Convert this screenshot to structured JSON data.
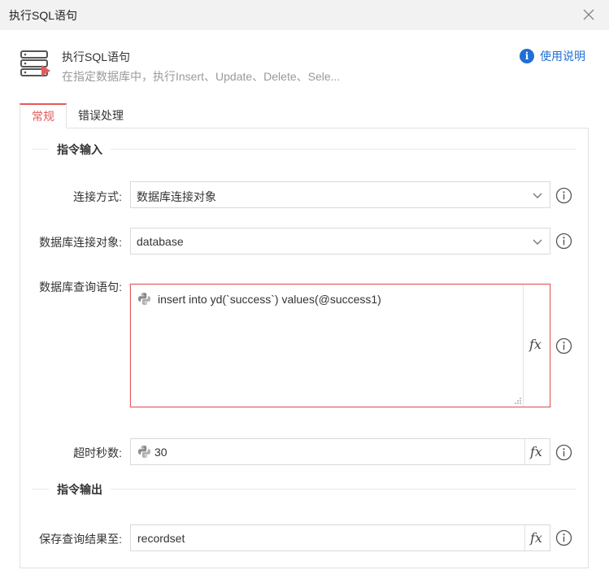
{
  "window": {
    "title": "执行SQL语句",
    "close_icon": "close-icon"
  },
  "header": {
    "icon": "sql-server-run-icon",
    "title": "执行SQL语句",
    "description": "在指定数据库中，执行Insert、Update、Delete、Sele...",
    "help_label": "使用说明",
    "help_icon": "info-circle-icon",
    "help_color": "#1f6fd6"
  },
  "tabs": [
    {
      "label": "常规",
      "active": true
    },
    {
      "label": "错误处理",
      "active": false
    }
  ],
  "sections": {
    "input_title": "指令输入",
    "output_title": "指令输出"
  },
  "fields": {
    "connection_mode": {
      "label": "连接方式:",
      "value": "数据库连接对象"
    },
    "connection_object": {
      "label": "数据库连接对象:",
      "value": "database"
    },
    "query": {
      "label": "数据库查询语句:",
      "value": "insert into yd(`success`)  values(@success1)"
    },
    "timeout": {
      "label": "超时秒数:",
      "value": "30"
    },
    "save_result": {
      "label": "保存查询结果至:",
      "value": "recordset"
    }
  },
  "fx_label": "fx",
  "accent_color": "#e45a5a"
}
